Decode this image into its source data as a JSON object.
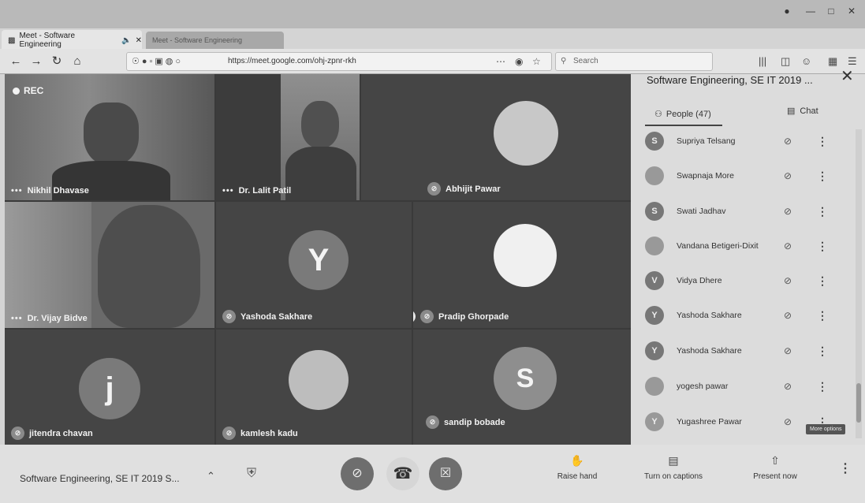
{
  "browser": {
    "active_tab": "Meet - Software Engineering",
    "inactive_tab": "Meet - Software Engineering",
    "url": "https://meet.google.com/ohj-zpnr-rkh",
    "search_placeholder": "Search"
  },
  "recording_label": "REC",
  "tiles": [
    {
      "name": "Nikhil Dhavase"
    },
    {
      "name": "Dr. Lalit Patil"
    },
    {
      "name": "Abhijit Pawar"
    },
    {
      "name": "Dr. Vijay Bidve"
    },
    {
      "name": "Yashoda Sakhare",
      "initial": "Y"
    },
    {
      "name": "Pradip Ghorpade"
    },
    {
      "name": "jitendra chavan",
      "initial": "j"
    },
    {
      "name": "kamlesh kadu"
    },
    {
      "name": "sandip bobade",
      "initial": "S"
    }
  ],
  "panel": {
    "title": "Software Engineering, SE IT 2019 ...",
    "people_tab": "People (47)",
    "chat_tab": "Chat",
    "more_options_tooltip": "More options",
    "people": [
      {
        "name": "Supriya Telsang",
        "initial": "S"
      },
      {
        "name": "Swapnaja More",
        "initial": ""
      },
      {
        "name": "Swati Jadhav",
        "initial": "S"
      },
      {
        "name": "Vandana Betigeri-Dixit",
        "initial": ""
      },
      {
        "name": "Vidya Dhere",
        "initial": "V"
      },
      {
        "name": "Yashoda Sakhare",
        "initial": "Y"
      },
      {
        "name": "Yashoda Sakhare",
        "initial": "Y"
      },
      {
        "name": "yogesh pawar",
        "initial": ""
      },
      {
        "name": "Yugashree Pawar",
        "initial": "Y"
      }
    ]
  },
  "bottom": {
    "meeting_title": "Software Engineering, SE IT 2019 S...",
    "raise_hand": "Raise hand",
    "captions": "Turn on captions",
    "present": "Present now"
  },
  "icons": [
    "mic-off-icon",
    "hang-up-icon",
    "camera-off-icon",
    "hand-icon",
    "cc-icon",
    "present-icon",
    "close-icon",
    "people-icon",
    "chat-icon",
    "more-vert-icon"
  ]
}
